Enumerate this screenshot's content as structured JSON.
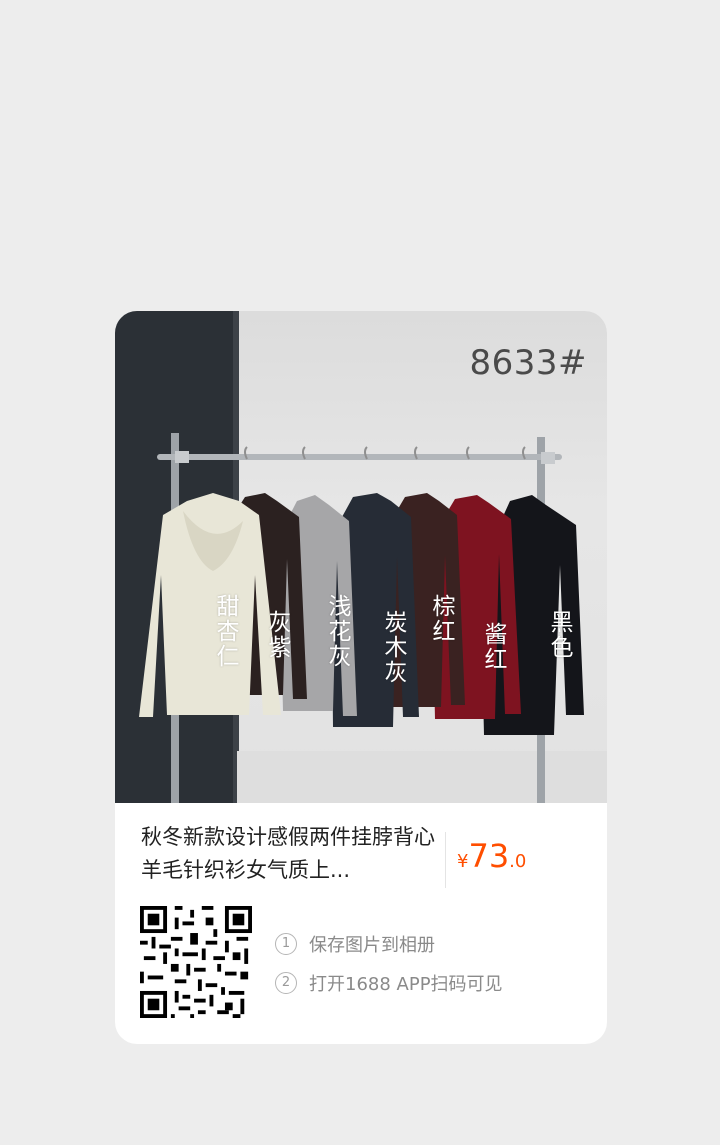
{
  "product": {
    "style_number": "8633#",
    "title": "秋冬新款设计感假两件挂脖背心羊毛针织衫女气质上...",
    "price": {
      "currency": "¥",
      "integer": "73",
      "decimal": ".0"
    },
    "colors": [
      "甜杏仁",
      "灰紫",
      "浅花灰",
      "炭木灰",
      "棕红",
      "酱红",
      "黑色"
    ]
  },
  "instructions": {
    "step1_num": "1",
    "step1_text": "保存图片到相册",
    "step2_num": "2",
    "step2_text": "打开1688 APP扫码可见"
  },
  "palette": {
    "background": "#ededed",
    "card": "#ffffff",
    "price_color": "#ff4e00",
    "text_primary": "#222222",
    "text_secondary": "#8a8a8a"
  }
}
